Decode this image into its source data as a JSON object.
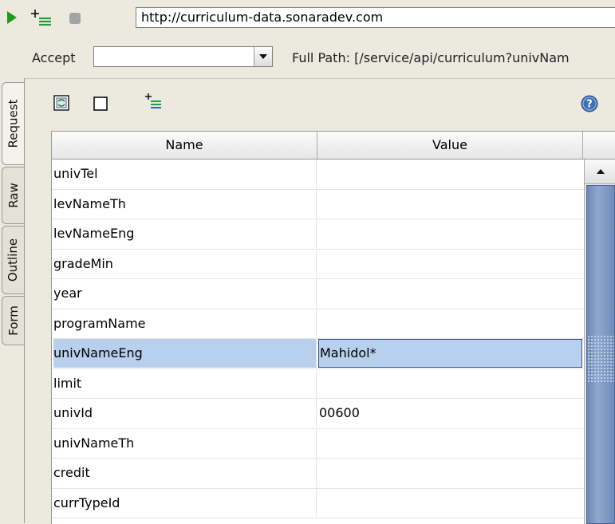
{
  "toolbar": {
    "url": "http://curriculum-data.sonaradev.com",
    "run_icon": "play-icon",
    "add_icon": "add-param-icon",
    "stop_icon": "stop-icon"
  },
  "accept": {
    "label": "Accept",
    "value": "",
    "full_path": "Full Path: [/service/api/curriculum?univNam"
  },
  "side_tabs": [
    "Request",
    "Raw",
    "Outline",
    "Form"
  ],
  "panel": {
    "icons": [
      "select-all-icon",
      "checkbox-icon",
      "add-row-icon",
      "help-icon"
    ]
  },
  "table": {
    "headers": [
      "Name",
      "Value"
    ],
    "rows": [
      {
        "name": "univTel",
        "value": ""
      },
      {
        "name": "levNameTh",
        "value": ""
      },
      {
        "name": "levNameEng",
        "value": ""
      },
      {
        "name": "gradeMin",
        "value": ""
      },
      {
        "name": "year",
        "value": ""
      },
      {
        "name": "programName",
        "value": ""
      },
      {
        "name": "univNameEng",
        "value": "Mahidol*"
      },
      {
        "name": "limit",
        "value": ""
      },
      {
        "name": "univId",
        "value": "00600"
      },
      {
        "name": "univNameTh",
        "value": ""
      },
      {
        "name": "credit",
        "value": ""
      },
      {
        "name": "currTypeId",
        "value": ""
      }
    ],
    "selected_row": 6
  },
  "colors": {
    "run": "#1e9a1e",
    "add": "#2a9a3a",
    "selection": "#b8d0ee",
    "scroll_thumb": "#7b97c2"
  }
}
